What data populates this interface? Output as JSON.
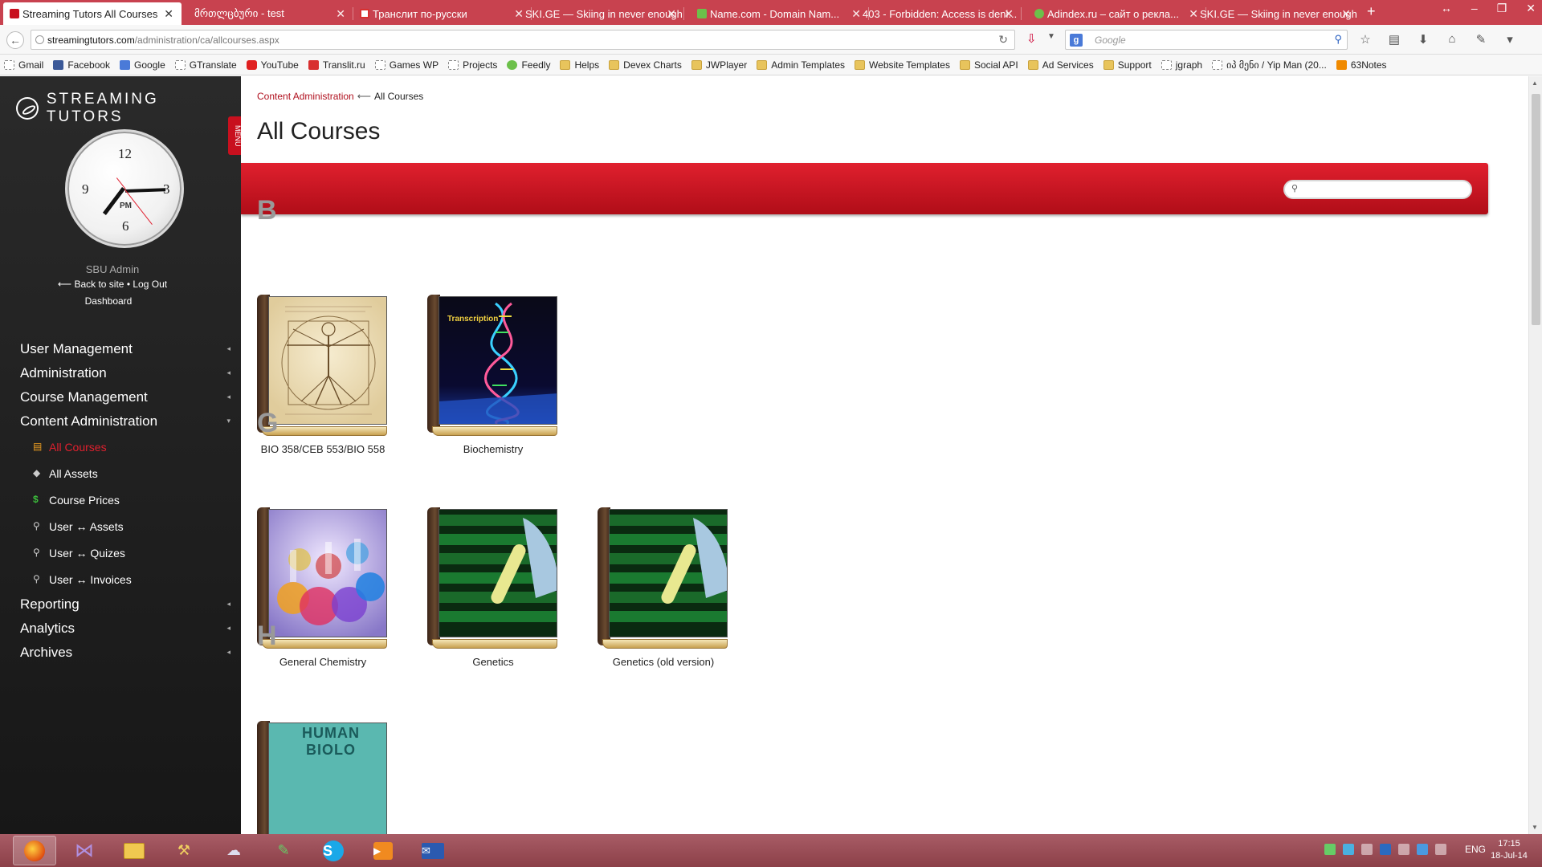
{
  "browser": {
    "tabs": [
      {
        "label": "Streaming Tutors All Courses",
        "favicon": "#c8101e"
      },
      {
        "label": "მრთლცბური - test",
        "favicon": "#ffffff"
      },
      {
        "label": "Транслит по-русски",
        "favicon": "#d83030"
      },
      {
        "label": "SKI.GE — Skiing in never enough",
        "favicon": "#ffffff"
      },
      {
        "label": "Name.com - Domain Nam...",
        "favicon": "#6cc04a"
      },
      {
        "label": "403 - Forbidden: Access is deni...",
        "favicon": "#ffffff"
      },
      {
        "label": "Adindex.ru – сайт о рекла...",
        "favicon": "#6cc04a"
      },
      {
        "label": "SKI.GE — Skiing in never enough",
        "favicon": "#ffffff"
      }
    ],
    "url_host": "streamingtutors.com",
    "url_path": "/administration/ca/allcourses.aspx",
    "search_engine_placeholder": "Google",
    "bookmarks": [
      {
        "label": "Gmail",
        "icon": "page"
      },
      {
        "label": "Facebook",
        "icon": "fb"
      },
      {
        "label": "Google",
        "icon": "goog"
      },
      {
        "label": "GTranslate",
        "icon": "page"
      },
      {
        "label": "YouTube",
        "icon": "yt"
      },
      {
        "label": "Translit.ru",
        "icon": "t"
      },
      {
        "label": "Games WP",
        "icon": "page"
      },
      {
        "label": "Projects",
        "icon": "page"
      },
      {
        "label": "Feedly",
        "icon": "feed"
      },
      {
        "label": "Helps",
        "icon": "folder"
      },
      {
        "label": "Devex Charts",
        "icon": "folder"
      },
      {
        "label": "JWPlayer",
        "icon": "folder"
      },
      {
        "label": "Admin Templates",
        "icon": "folder"
      },
      {
        "label": "Website Templates",
        "icon": "folder"
      },
      {
        "label": "Social API",
        "icon": "folder"
      },
      {
        "label": "Ad Services",
        "icon": "folder"
      },
      {
        "label": "Support",
        "icon": "folder"
      },
      {
        "label": "jgraph",
        "icon": "page"
      },
      {
        "label": "იპ მენი / Yip Man (20...",
        "icon": "page"
      },
      {
        "label": "63Notes",
        "icon": "n63"
      }
    ]
  },
  "sidebar": {
    "brand": "STREAMING TUTORS",
    "menu_tag": "MENU",
    "clock": {
      "pm": "PM",
      "n12": "12",
      "n3": "3",
      "n6": "6",
      "n9": "9"
    },
    "user_name": "SBU Admin",
    "back_link": "⟵ Back to site",
    "dot": "•",
    "logout_link": "Log Out",
    "dashboard_link": "Dashboard",
    "menu": [
      {
        "label": "User Management",
        "caret": "◂"
      },
      {
        "label": "Administration",
        "caret": "◂"
      },
      {
        "label": "Course Management",
        "caret": "◂"
      },
      {
        "label": "Content Administration",
        "caret": "▾"
      }
    ],
    "submenu": [
      {
        "label": "All Courses",
        "icon": "▤",
        "active": true
      },
      {
        "label": "All Assets",
        "icon": "◆"
      },
      {
        "label": "Course Prices",
        "icon": "$"
      },
      {
        "label": "User ↔ Assets",
        "icon": "⚲"
      },
      {
        "label": "User ↔ Quizes",
        "icon": "⚲"
      },
      {
        "label": "User ↔ Invoices",
        "icon": "⚲"
      }
    ],
    "menu2": [
      {
        "label": "Reporting",
        "caret": "◂"
      },
      {
        "label": "Analytics",
        "caret": "◂"
      },
      {
        "label": "Archives",
        "caret": "◂"
      }
    ]
  },
  "main": {
    "breadcrumb_parent": "Content Administration",
    "breadcrumb_sep": "⟵",
    "breadcrumb_current": "All Courses",
    "title": "All Courses",
    "search_placeholder": "",
    "groups": [
      {
        "letter": "B",
        "courses": [
          {
            "name": "BIO 358/CEB 553/BIO 558",
            "cover": "vitruvian"
          },
          {
            "name": "Biochemistry",
            "cover": "dna",
            "cover_text": "Transcription"
          }
        ]
      },
      {
        "letter": "G",
        "courses": [
          {
            "name": "General Chemistry",
            "cover": "chem"
          },
          {
            "name": "Genetics",
            "cover": "gen"
          },
          {
            "name": "Genetics (old version)",
            "cover": "gen"
          }
        ]
      },
      {
        "letter": "H",
        "courses": [
          {
            "name": "",
            "cover": "human",
            "cover_text": "HUMAN BIOLO"
          }
        ]
      }
    ]
  },
  "taskbar": {
    "apps": [
      "firefox-icon",
      "visual-studio-icon",
      "file-explorer-icon",
      "tools-icon",
      "network-icon",
      "paint-icon",
      "skype-icon",
      "media-player-icon",
      "mail-icon"
    ],
    "lang": "ENG",
    "time": "17:15",
    "date": "18-Jul-14"
  },
  "colors": {
    "accent": "#c8101e",
    "tabbar": "#c8424f",
    "sidebar": "#222222"
  }
}
